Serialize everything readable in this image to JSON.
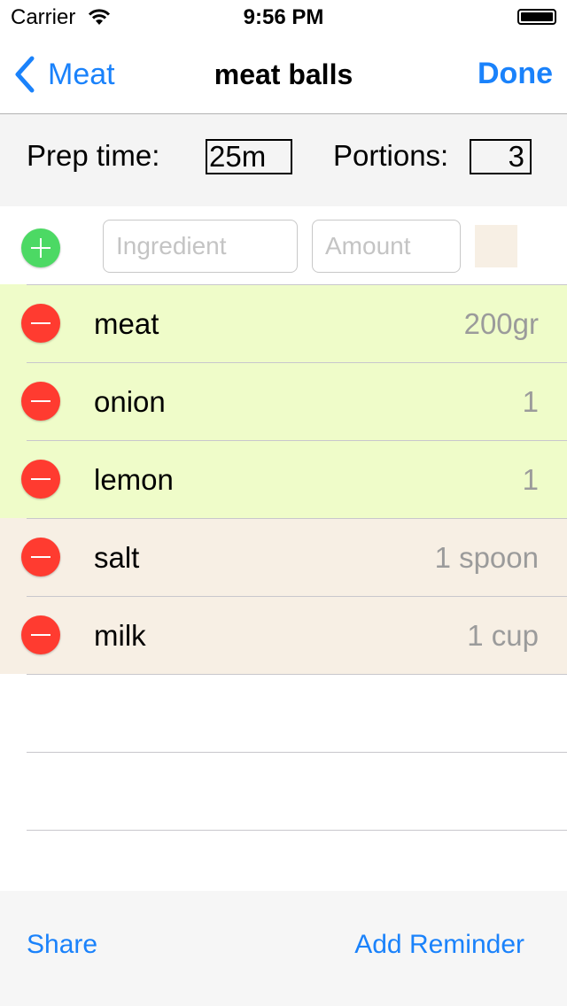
{
  "status_bar": {
    "carrier": "Carrier",
    "time": "9:56 PM",
    "wifi_icon": "wifi-icon",
    "battery_icon": "battery-icon"
  },
  "nav": {
    "back_label": "Meat",
    "title": "meat balls",
    "done_label": "Done"
  },
  "prep": {
    "prep_label": "Prep time:",
    "prep_value": "25m",
    "portions_label": "Portions:",
    "portions_value": "3"
  },
  "add_row": {
    "ingredient_placeholder": "Ingredient",
    "amount_placeholder": "Amount",
    "ingredient_value": "",
    "amount_value": "",
    "swatch_color": "#f7efe4"
  },
  "ingredients": [
    {
      "name": "meat",
      "amount": "200gr",
      "bg": "#effcc9"
    },
    {
      "name": "onion",
      "amount": "1",
      "bg": "#effcc9"
    },
    {
      "name": "lemon",
      "amount": "1",
      "bg": "#effcc9"
    },
    {
      "name": "salt",
      "amount": "1 spoon",
      "bg": "#f7efe4"
    },
    {
      "name": "milk",
      "amount": "1 cup",
      "bg": "#f7efe4"
    }
  ],
  "toolbar": {
    "share_label": "Share",
    "reminder_label": "Add Reminder"
  },
  "colors": {
    "accent": "#1a82fb",
    "add": "#4cd964",
    "delete": "#ff3b30"
  }
}
